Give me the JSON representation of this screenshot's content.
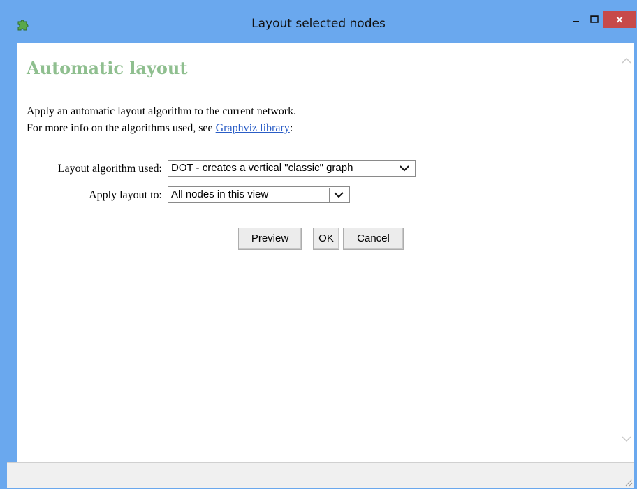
{
  "window": {
    "title": "Layout selected nodes",
    "close_glyph": "×",
    "icons": {
      "app": "puzzle-piece-icon",
      "minimize": "minimize-icon",
      "maximize": "maximize-icon",
      "close": "close-icon"
    }
  },
  "content": {
    "heading": "Automatic layout",
    "desc_line1": "Apply an automatic layout algorithm to the current network.",
    "desc_line2_prefix": "For more info on the algorithms used, see ",
    "desc_link": "Graphviz library",
    "desc_line2_suffix": ":"
  },
  "form": {
    "algorithm_label": "Layout algorithm used:",
    "algorithm_value": "DOT - creates a vertical \"classic\" graph",
    "apply_label": "Apply layout to:",
    "apply_value": "All nodes in this view"
  },
  "buttons": {
    "preview": "Preview",
    "ok": "OK",
    "cancel": "Cancel"
  },
  "colors": {
    "titlebar": "#6aa8ee",
    "heading": "#8fbf8f",
    "link": "#2a5dc6",
    "close_button": "#c74a4a"
  }
}
